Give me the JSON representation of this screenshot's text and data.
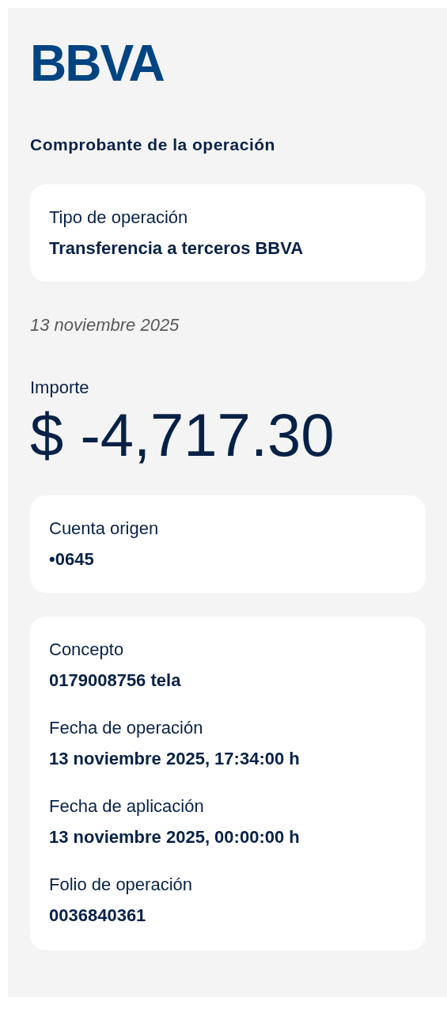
{
  "logo": "BBVA",
  "title": "Comprobante de la operación",
  "operation_card": {
    "label": "Tipo de operación",
    "value": "Transferencia a terceros BBVA"
  },
  "date": "13 noviembre 2025",
  "amount": {
    "label": "Importe",
    "value": "$ -4,717.30"
  },
  "account_card": {
    "label": "Cuenta origen",
    "value": "•0645"
  },
  "details": [
    {
      "label": "Concepto",
      "value": "0179008756 tela"
    },
    {
      "label": "Fecha de operación",
      "value": "13 noviembre 2025, 17:34:00 h"
    },
    {
      "label": "Fecha de aplicación",
      "value": "13 noviembre 2025, 00:00:00 h"
    },
    {
      "label": "Folio de operación",
      "value": "0036840361"
    }
  ]
}
